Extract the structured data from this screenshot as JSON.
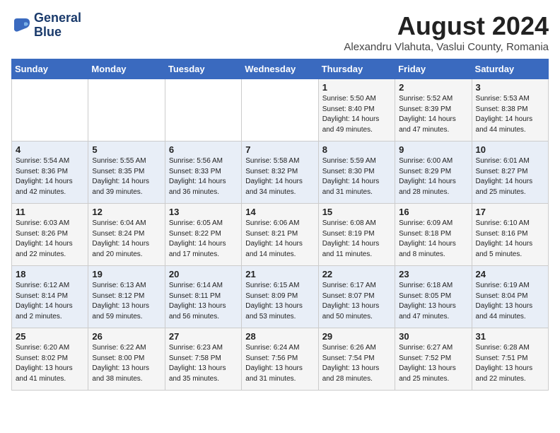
{
  "logo": {
    "line1": "General",
    "line2": "Blue"
  },
  "title": "August 2024",
  "subtitle": "Alexandru Vlahuta, Vaslui County, Romania",
  "weekdays": [
    "Sunday",
    "Monday",
    "Tuesday",
    "Wednesday",
    "Thursday",
    "Friday",
    "Saturday"
  ],
  "weeks": [
    [
      {
        "day": "",
        "info": ""
      },
      {
        "day": "",
        "info": ""
      },
      {
        "day": "",
        "info": ""
      },
      {
        "day": "",
        "info": ""
      },
      {
        "day": "1",
        "info": "Sunrise: 5:50 AM\nSunset: 8:40 PM\nDaylight: 14 hours\nand 49 minutes."
      },
      {
        "day": "2",
        "info": "Sunrise: 5:52 AM\nSunset: 8:39 PM\nDaylight: 14 hours\nand 47 minutes."
      },
      {
        "day": "3",
        "info": "Sunrise: 5:53 AM\nSunset: 8:38 PM\nDaylight: 14 hours\nand 44 minutes."
      }
    ],
    [
      {
        "day": "4",
        "info": "Sunrise: 5:54 AM\nSunset: 8:36 PM\nDaylight: 14 hours\nand 42 minutes."
      },
      {
        "day": "5",
        "info": "Sunrise: 5:55 AM\nSunset: 8:35 PM\nDaylight: 14 hours\nand 39 minutes."
      },
      {
        "day": "6",
        "info": "Sunrise: 5:56 AM\nSunset: 8:33 PM\nDaylight: 14 hours\nand 36 minutes."
      },
      {
        "day": "7",
        "info": "Sunrise: 5:58 AM\nSunset: 8:32 PM\nDaylight: 14 hours\nand 34 minutes."
      },
      {
        "day": "8",
        "info": "Sunrise: 5:59 AM\nSunset: 8:30 PM\nDaylight: 14 hours\nand 31 minutes."
      },
      {
        "day": "9",
        "info": "Sunrise: 6:00 AM\nSunset: 8:29 PM\nDaylight: 14 hours\nand 28 minutes."
      },
      {
        "day": "10",
        "info": "Sunrise: 6:01 AM\nSunset: 8:27 PM\nDaylight: 14 hours\nand 25 minutes."
      }
    ],
    [
      {
        "day": "11",
        "info": "Sunrise: 6:03 AM\nSunset: 8:26 PM\nDaylight: 14 hours\nand 22 minutes."
      },
      {
        "day": "12",
        "info": "Sunrise: 6:04 AM\nSunset: 8:24 PM\nDaylight: 14 hours\nand 20 minutes."
      },
      {
        "day": "13",
        "info": "Sunrise: 6:05 AM\nSunset: 8:22 PM\nDaylight: 14 hours\nand 17 minutes."
      },
      {
        "day": "14",
        "info": "Sunrise: 6:06 AM\nSunset: 8:21 PM\nDaylight: 14 hours\nand 14 minutes."
      },
      {
        "day": "15",
        "info": "Sunrise: 6:08 AM\nSunset: 8:19 PM\nDaylight: 14 hours\nand 11 minutes."
      },
      {
        "day": "16",
        "info": "Sunrise: 6:09 AM\nSunset: 8:18 PM\nDaylight: 14 hours\nand 8 minutes."
      },
      {
        "day": "17",
        "info": "Sunrise: 6:10 AM\nSunset: 8:16 PM\nDaylight: 14 hours\nand 5 minutes."
      }
    ],
    [
      {
        "day": "18",
        "info": "Sunrise: 6:12 AM\nSunset: 8:14 PM\nDaylight: 14 hours\nand 2 minutes."
      },
      {
        "day": "19",
        "info": "Sunrise: 6:13 AM\nSunset: 8:12 PM\nDaylight: 13 hours\nand 59 minutes."
      },
      {
        "day": "20",
        "info": "Sunrise: 6:14 AM\nSunset: 8:11 PM\nDaylight: 13 hours\nand 56 minutes."
      },
      {
        "day": "21",
        "info": "Sunrise: 6:15 AM\nSunset: 8:09 PM\nDaylight: 13 hours\nand 53 minutes."
      },
      {
        "day": "22",
        "info": "Sunrise: 6:17 AM\nSunset: 8:07 PM\nDaylight: 13 hours\nand 50 minutes."
      },
      {
        "day": "23",
        "info": "Sunrise: 6:18 AM\nSunset: 8:05 PM\nDaylight: 13 hours\nand 47 minutes."
      },
      {
        "day": "24",
        "info": "Sunrise: 6:19 AM\nSunset: 8:04 PM\nDaylight: 13 hours\nand 44 minutes."
      }
    ],
    [
      {
        "day": "25",
        "info": "Sunrise: 6:20 AM\nSunset: 8:02 PM\nDaylight: 13 hours\nand 41 minutes."
      },
      {
        "day": "26",
        "info": "Sunrise: 6:22 AM\nSunset: 8:00 PM\nDaylight: 13 hours\nand 38 minutes."
      },
      {
        "day": "27",
        "info": "Sunrise: 6:23 AM\nSunset: 7:58 PM\nDaylight: 13 hours\nand 35 minutes."
      },
      {
        "day": "28",
        "info": "Sunrise: 6:24 AM\nSunset: 7:56 PM\nDaylight: 13 hours\nand 31 minutes."
      },
      {
        "day": "29",
        "info": "Sunrise: 6:26 AM\nSunset: 7:54 PM\nDaylight: 13 hours\nand 28 minutes."
      },
      {
        "day": "30",
        "info": "Sunrise: 6:27 AM\nSunset: 7:52 PM\nDaylight: 13 hours\nand 25 minutes."
      },
      {
        "day": "31",
        "info": "Sunrise: 6:28 AM\nSunset: 7:51 PM\nDaylight: 13 hours\nand 22 minutes."
      }
    ]
  ]
}
